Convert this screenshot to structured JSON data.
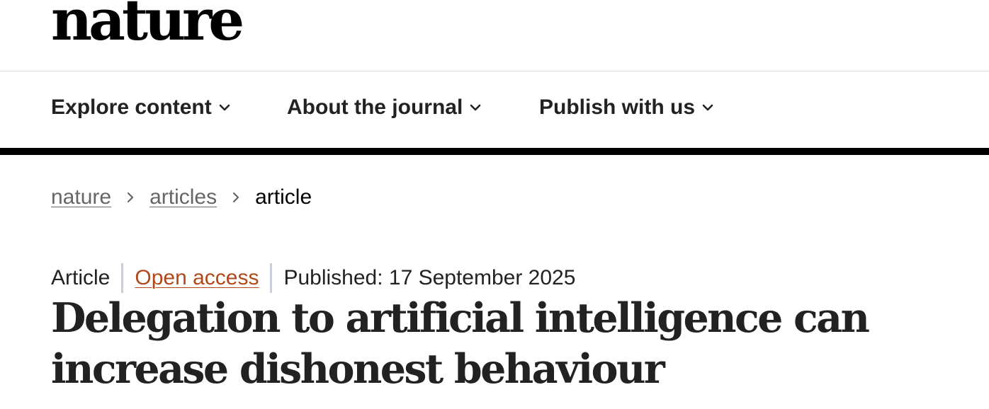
{
  "header": {
    "logo_text": "nature"
  },
  "nav": {
    "items": [
      {
        "label": "Explore content",
        "icon": "chevron-down-icon"
      },
      {
        "label": "About the journal",
        "icon": "chevron-down-icon"
      },
      {
        "label": "Publish with us",
        "icon": "chevron-down-icon"
      }
    ]
  },
  "breadcrumb": {
    "items": [
      {
        "label": "nature"
      },
      {
        "label": "articles"
      },
      {
        "label": "article"
      }
    ],
    "separator_icon": "chevron-right-icon"
  },
  "article": {
    "type": "Article",
    "access": "Open access",
    "published": "Published: 17 September 2025",
    "title": "Delegation to artificial intelligence can increase dishonest behaviour"
  },
  "colors": {
    "text": "#222222",
    "link_gray": "#666666",
    "open_access": "#b0481a",
    "divider": "#c6d0dc",
    "nav_rule": "#000000"
  }
}
